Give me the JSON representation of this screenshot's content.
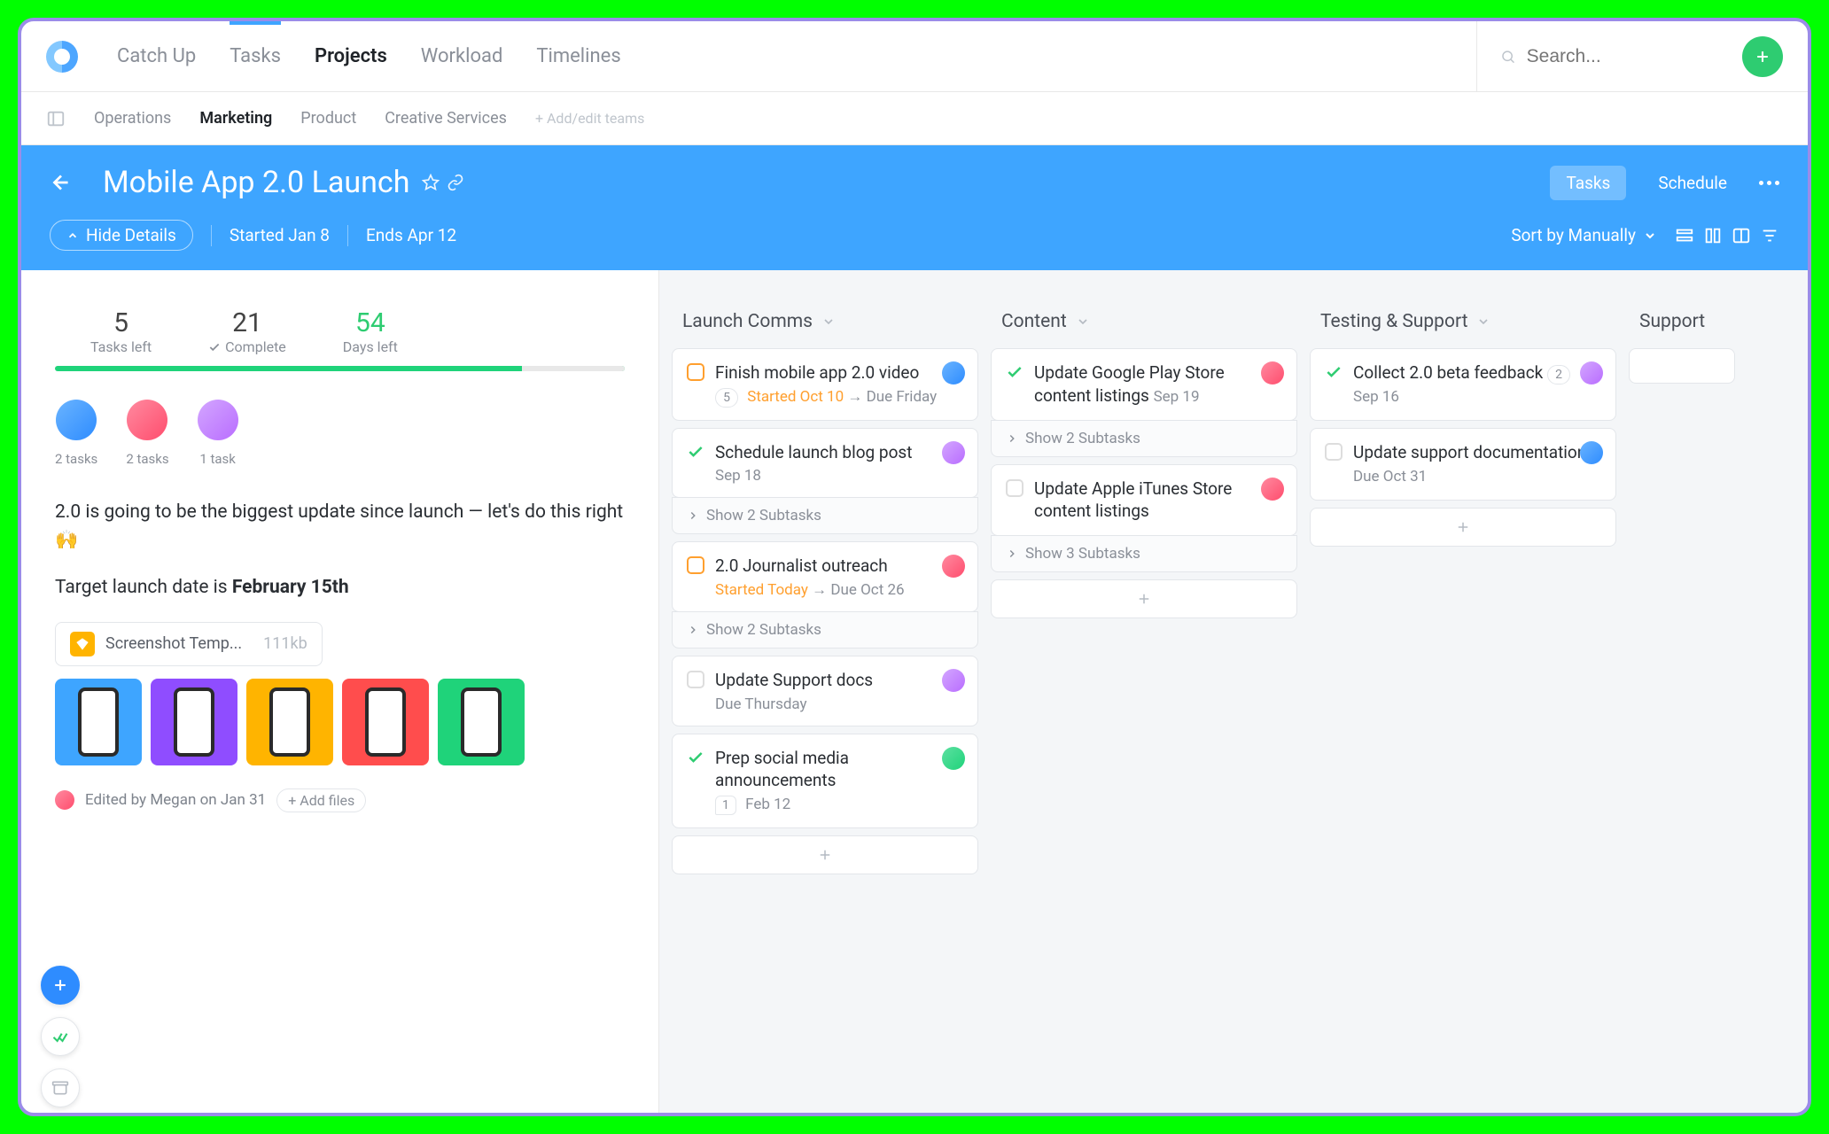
{
  "nav": {
    "tabs": [
      "Catch Up",
      "Tasks",
      "Projects",
      "Workload",
      "Timelines"
    ],
    "search_placeholder": "Search..."
  },
  "teams": {
    "items": [
      "Operations",
      "Marketing",
      "Product",
      "Creative Services"
    ],
    "add": "+ Add/edit teams"
  },
  "header": {
    "title": "Mobile App 2.0 Launch",
    "views": [
      "Tasks",
      "Schedule"
    ],
    "hide_details": "Hide Details",
    "started": "Started Jan 8",
    "ends": "Ends Apr 12",
    "sort": "Sort by Manually"
  },
  "stats": {
    "tasks_left": {
      "num": "5",
      "label": "Tasks left"
    },
    "complete": {
      "num": "21",
      "label": "Complete"
    },
    "days_left": {
      "num": "54",
      "label": "Days left"
    }
  },
  "assignees": [
    {
      "color": "#4a8ff5",
      "count": "2 tasks"
    },
    {
      "color": "#ff4d6d",
      "count": "2 tasks"
    },
    {
      "color": "#b96dff",
      "count": "1 task"
    }
  ],
  "description": {
    "line1_a": "2.0 is going to be the biggest update since launch — let's do this right ",
    "emoji": "🙌",
    "line2_a": "Target launch date is ",
    "line2_b": "February 15th"
  },
  "file": {
    "name": "Screenshot Temp...",
    "size": "111kb"
  },
  "thumbs": [
    "#3ea5ff",
    "#8f4dff",
    "#ffb400",
    "#ff4d4d",
    "#1fd37a"
  ],
  "edited": "Edited by Megan on Jan 31",
  "add_files": "+ Add files",
  "columns": [
    {
      "title": "Launch Comms",
      "cards": [
        {
          "check": "orange",
          "title": "Finish mobile app 2.0 video",
          "pill": "5",
          "started": "Started Oct 10",
          "arrow": "→",
          "due": "Due Friday",
          "avatar": "#4a8ff5",
          "subtasks": null
        },
        {
          "check": "done",
          "title": "Schedule launch blog post",
          "date": "Sep 18",
          "avatar": "#b96dff",
          "subtasks": "Show 2 Subtasks"
        },
        {
          "check": "orange",
          "title": "2.0 Journalist outreach",
          "started": "Started Today",
          "arrow": "→",
          "due": "Due Oct 26",
          "avatar": "#ff4d6d",
          "subtasks": "Show 2 Subtasks"
        },
        {
          "check": "empty",
          "title": "Update Support docs",
          "date": "Due Thursday",
          "avatar": "#b96dff",
          "subtasks": null
        },
        {
          "check": "done",
          "title": "Prep social media announcements",
          "comment": "1",
          "date": "Feb 12",
          "avatar": "#1fd37a",
          "subtasks": null
        }
      ]
    },
    {
      "title": "Content",
      "cards": [
        {
          "check": "done",
          "title": "Update Google Play Store content listings",
          "date": "Sep 19",
          "avatar": "#ff4d6d",
          "subtasks": "Show 2 Subtasks"
        },
        {
          "check": "empty",
          "title": "Update Apple iTunes Store content listings",
          "avatar": "#ff4d6d",
          "subtasks": "Show 3 Subtasks"
        }
      ]
    },
    {
      "title": "Testing & Support",
      "cards": [
        {
          "check": "done",
          "title": "Collect 2.0 beta feedback",
          "pill": "2",
          "date": "Sep 16",
          "avatar": "#b96dff",
          "subtasks": null
        },
        {
          "check": "empty",
          "title": "Update support documentation",
          "date": "Due Oct 31",
          "avatar": "#4a8ff5",
          "subtasks": null
        }
      ]
    },
    {
      "title": "Support",
      "cards": []
    }
  ]
}
